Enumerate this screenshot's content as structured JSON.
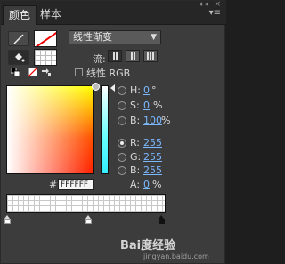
{
  "tabs": [
    {
      "label": "颜色",
      "active": true
    },
    {
      "label": "样本",
      "active": false
    }
  ],
  "tab_menu_icon": "menu-icon",
  "fill_type": {
    "selected": "线性渐变"
  },
  "flow": {
    "label": "流:"
  },
  "linear_rgb": {
    "label": "线性 RGB",
    "checked": false
  },
  "hsb": {
    "h": {
      "label": "H:",
      "value": "0",
      "unit": "°"
    },
    "s": {
      "label": "S:",
      "value": "0",
      "unit": "%"
    },
    "b": {
      "label": "B:",
      "value": "100",
      "unit": "%"
    }
  },
  "rgb": {
    "r": {
      "label": "R:",
      "value": "255"
    },
    "g": {
      "label": "G:",
      "value": "255"
    },
    "b": {
      "label": "B:",
      "value": "255"
    }
  },
  "alpha": {
    "label": "A:",
    "value": "0",
    "unit": "%"
  },
  "hex": {
    "label": "#",
    "value": "FFFFFF"
  },
  "selected_mode": "R",
  "watermark": {
    "text": "Bai度经验",
    "sub": "jingyan.baidu.com"
  },
  "colors": {
    "accent": "#7ab8ff",
    "panel": "#3c3c3c"
  }
}
